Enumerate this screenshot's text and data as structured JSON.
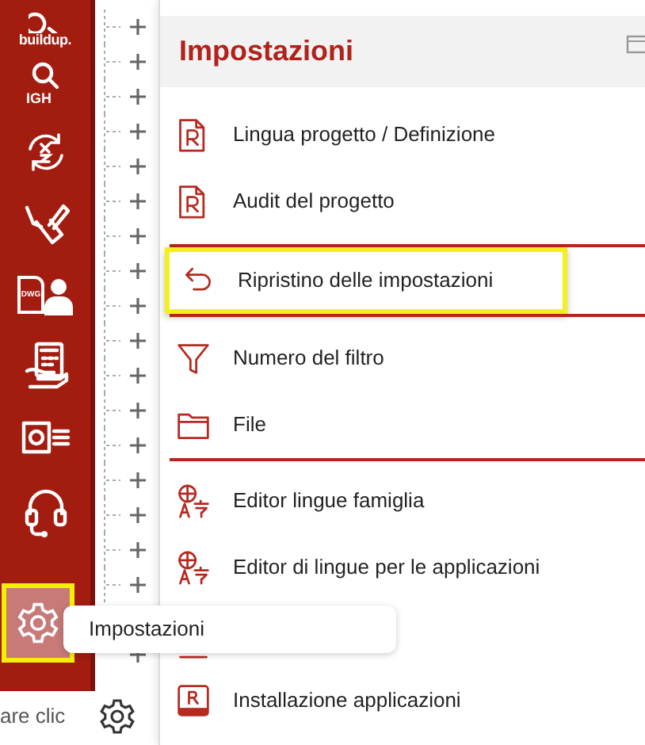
{
  "sidebar": {
    "items": [
      {
        "kind": "buildup",
        "label": "buildup.",
        "selected": false
      },
      {
        "kind": "search",
        "label": "IGH",
        "selected": false
      },
      {
        "kind": "rotate",
        "selected": false
      },
      {
        "kind": "pencil",
        "selected": false
      },
      {
        "kind": "dwg",
        "label": "DWG",
        "selected": false
      },
      {
        "kind": "calculator",
        "selected": false
      },
      {
        "kind": "idcard",
        "selected": false
      },
      {
        "kind": "headset",
        "selected": false
      },
      {
        "kind": "gear",
        "selected": true
      }
    ],
    "status_text": "are clic"
  },
  "tooltip": {
    "text": "Impostazioni"
  },
  "panel": {
    "title": "Impostazioni",
    "sections": [
      {
        "items": [
          {
            "kind": "rfile",
            "label": "Lingua progetto / Definizione",
            "highlighted": false
          },
          {
            "kind": "rfile",
            "label": "Audit del progetto",
            "highlighted": false
          }
        ]
      },
      {
        "items": [
          {
            "kind": "undo",
            "label": "Ripristino delle impostazioni",
            "highlighted": true
          }
        ]
      },
      {
        "items": [
          {
            "kind": "funnel",
            "label": "Numero del filtro",
            "highlighted": false
          },
          {
            "kind": "folder",
            "label": "File",
            "highlighted": false
          }
        ]
      },
      {
        "items": [
          {
            "kind": "translate",
            "label": "Editor lingue famiglia",
            "highlighted": false
          },
          {
            "kind": "translate",
            "label": "Editor di lingue per le applicazioni",
            "highlighted": false
          },
          {
            "kind": "list",
            "highlighted": false
          },
          {
            "kind": "rbox",
            "label": "Installazione applicazioni",
            "highlighted": false
          }
        ]
      }
    ]
  }
}
